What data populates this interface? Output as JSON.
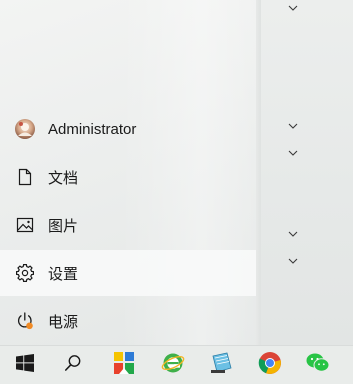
{
  "start_menu": {
    "user": {
      "label": "Administrator",
      "icon": "user-avatar-icon"
    },
    "items": [
      {
        "label": "文档",
        "icon": "document-icon"
      },
      {
        "label": "图片",
        "icon": "pictures-icon"
      },
      {
        "label": "设置",
        "icon": "gear-icon"
      },
      {
        "label": "电源",
        "icon": "power-icon"
      }
    ]
  },
  "taskbar": {
    "buttons": [
      {
        "name": "start-button",
        "icon": "windows-logo-icon"
      },
      {
        "name": "search-button",
        "icon": "search-icon"
      },
      {
        "name": "app-store-button",
        "icon": "colorful-app-icon"
      },
      {
        "name": "browser-ie-button",
        "icon": "green-e-browser-icon"
      },
      {
        "name": "notepad-button",
        "icon": "notebook-icon"
      },
      {
        "name": "chrome-button",
        "icon": "chrome-icon"
      },
      {
        "name": "wechat-button",
        "icon": "wechat-icon"
      }
    ]
  },
  "colors": {
    "accent_orange": "#f08a24",
    "windows_blue": "#1a1a1a"
  }
}
